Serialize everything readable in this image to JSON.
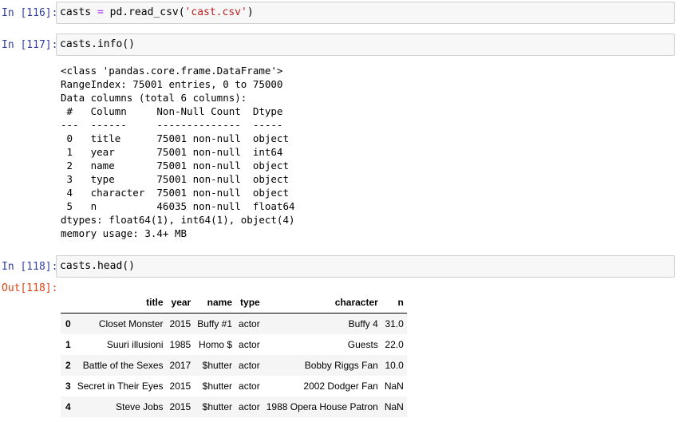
{
  "cells": [
    {
      "prompt": "In [116]:",
      "code": {
        "var": "casts",
        "eq": " = ",
        "call": "pd.read_csv(",
        "arg": "'cast.csv'",
        "close": ")"
      }
    },
    {
      "prompt": "In [117]:",
      "code": "casts.info()"
    },
    {
      "prompt": "In [118]:",
      "code": "casts.head()",
      "out_prompt": "Out[118]:"
    }
  ],
  "info_output": "<class 'pandas.core.frame.DataFrame'>\nRangeIndex: 75001 entries, 0 to 75000\nData columns (total 6 columns):\n #   Column     Non-Null Count  Dtype  \n---  ------     --------------  -----  \n 0   title      75001 non-null  object \n 1   year       75001 non-null  int64  \n 2   name       75001 non-null  object \n 3   type       75001 non-null  object \n 4   character  75001 non-null  object \n 5   n          46035 non-null  float64\ndtypes: float64(1), int64(1), object(4)\nmemory usage: 3.4+ MB",
  "table": {
    "columns": [
      "",
      "title",
      "year",
      "name",
      "type",
      "character",
      "n"
    ],
    "rows": [
      [
        "0",
        "Closet Monster",
        "2015",
        "Buffy #1",
        "actor",
        "Buffy 4",
        "31.0"
      ],
      [
        "1",
        "Suuri illusioni",
        "1985",
        "Homo $",
        "actor",
        "Guests",
        "22.0"
      ],
      [
        "2",
        "Battle of the Sexes",
        "2017",
        "$hutter",
        "actor",
        "Bobby Riggs Fan",
        "10.0"
      ],
      [
        "3",
        "Secret in Their Eyes",
        "2015",
        "$hutter",
        "actor",
        "2002 Dodger Fan",
        "NaN"
      ],
      [
        "4",
        "Steve Jobs",
        "2015",
        "$hutter",
        "actor",
        "1988 Opera House Patron",
        "NaN"
      ]
    ]
  }
}
